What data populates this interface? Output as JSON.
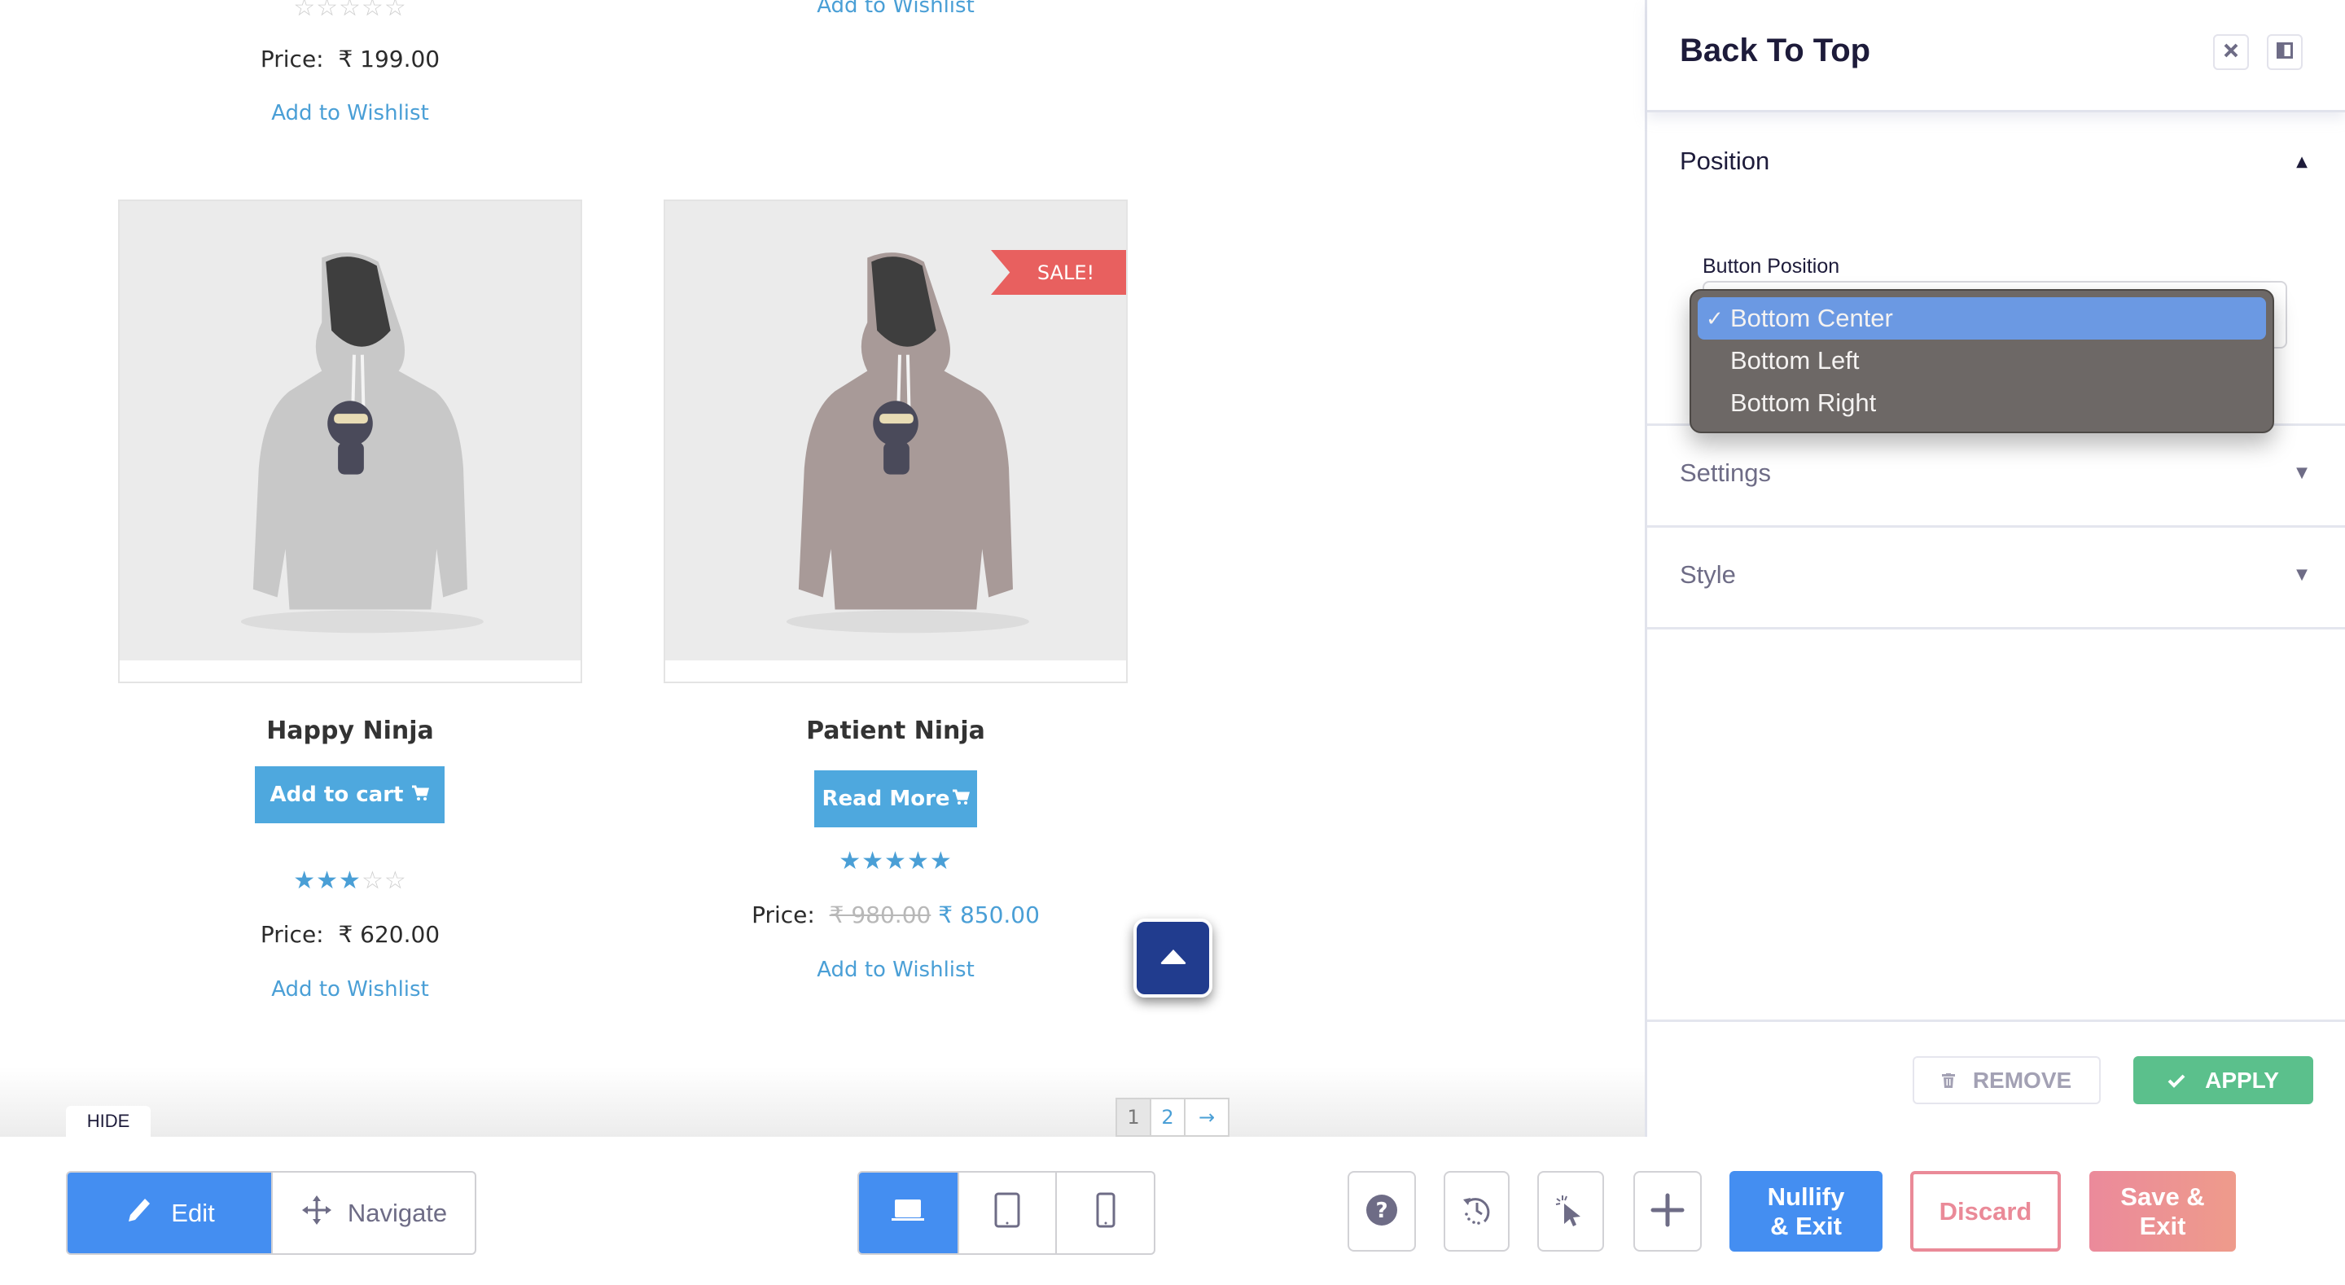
{
  "shop": {
    "top_partial": {
      "left": {
        "rating": 0,
        "price_label": "Price:",
        "price": "₹ 199.00",
        "wishlist": "Add to Wishlist"
      },
      "right": {
        "wishlist": "Add to Wishlist"
      }
    },
    "products": [
      {
        "name": "Happy Ninja",
        "button_label": "Add to cart",
        "button_icon": "cart-icon",
        "rating": 3,
        "rating_max": 5,
        "price_label": "Price:",
        "price": "₹ 620.00",
        "old_price": null,
        "wishlist": "Add to Wishlist",
        "hoodie_color": "#c8c8c8",
        "sale_badge": null
      },
      {
        "name": "Patient Ninja",
        "button_label": "Read More",
        "button_icon": "cart-icon",
        "rating": 5,
        "rating_max": 5,
        "price_label": "Price:",
        "price": "₹ 850.00",
        "old_price": "₹ 980.00",
        "wishlist": "Add to Wishlist",
        "hoodie_color": "#a89a98",
        "sale_badge": "SALE!"
      }
    ],
    "pagination": {
      "pages": [
        "1",
        "2"
      ],
      "current": "1",
      "next": "→"
    },
    "back_to_top_icon": "caret-up-icon"
  },
  "panel": {
    "title": "Back To Top",
    "close_icon": "close-icon",
    "dock_icon": "panel-toggle-icon",
    "sections": [
      {
        "label": "Position",
        "expanded": true
      },
      {
        "label": "Settings",
        "expanded": false
      },
      {
        "label": "Style",
        "expanded": false
      }
    ],
    "field_label": "Button Position",
    "select": {
      "selected": "Bottom Center",
      "options": [
        "Bottom Center",
        "Bottom Left",
        "Bottom Right"
      ]
    },
    "remove_label": "REMOVE",
    "apply_label": "APPLY"
  },
  "toolbar": {
    "hide_label": "HIDE",
    "modes": [
      {
        "label": "Edit",
        "icon": "pencil-icon",
        "active": true
      },
      {
        "label": "Navigate",
        "icon": "move-icon",
        "active": false
      }
    ],
    "devices": [
      {
        "name": "desktop",
        "icon": "laptop-icon",
        "active": true
      },
      {
        "name": "tablet",
        "icon": "tablet-icon",
        "active": false
      },
      {
        "name": "mobile",
        "icon": "phone-icon",
        "active": false
      }
    ],
    "tools": [
      "help-icon",
      "history-icon",
      "select-cursor-icon",
      "add-icon"
    ],
    "nullify_label": "Nullify & Exit",
    "discard_label": "Discard",
    "save_label": "Save & Exit",
    "colors": {
      "primary": "#448ef1",
      "danger": "#ea8a98",
      "success": "#5bc08c",
      "back_to_top": "#213c8e"
    }
  }
}
